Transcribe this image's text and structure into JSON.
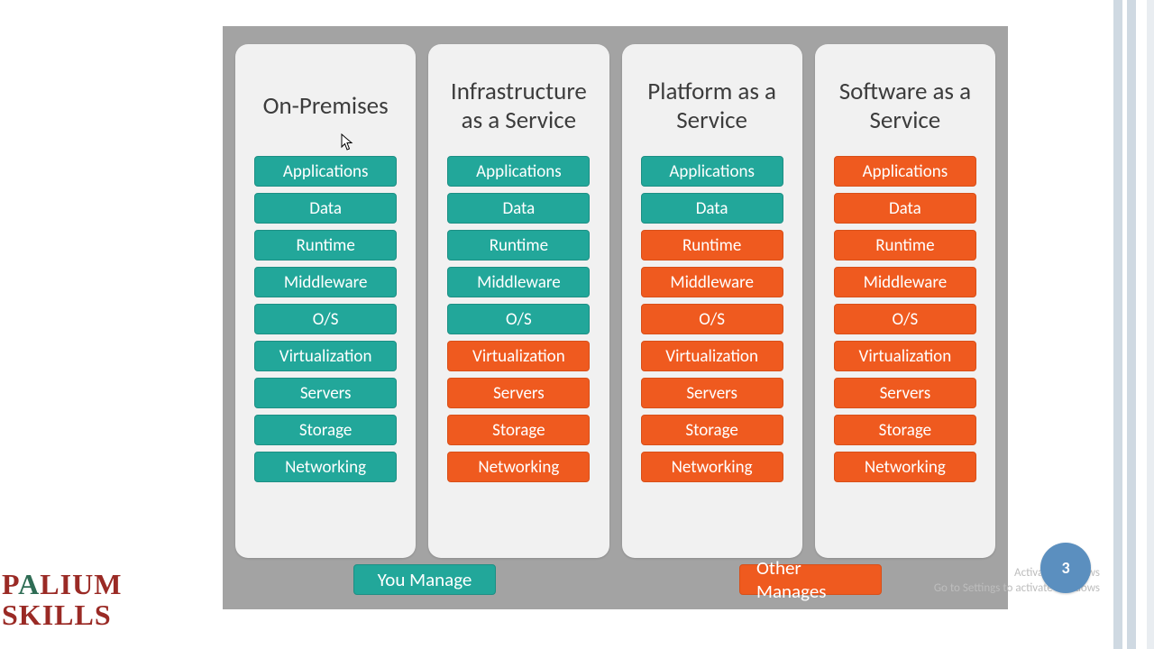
{
  "colors": {
    "teal": "#22a79a",
    "orange": "#ef5a1f",
    "panel": "#a3a3a3"
  },
  "columns": [
    {
      "title": "On-Premises",
      "rows": [
        {
          "label": "Applications",
          "managed": "you"
        },
        {
          "label": "Data",
          "managed": "you"
        },
        {
          "label": "Runtime",
          "managed": "you"
        },
        {
          "label": "Middleware",
          "managed": "you"
        },
        {
          "label": "O/S",
          "managed": "you"
        },
        {
          "label": "Virtualization",
          "managed": "you"
        },
        {
          "label": "Servers",
          "managed": "you"
        },
        {
          "label": "Storage",
          "managed": "you"
        },
        {
          "label": "Networking",
          "managed": "you"
        }
      ]
    },
    {
      "title": "Infrastructure as a Service",
      "rows": [
        {
          "label": "Applications",
          "managed": "you"
        },
        {
          "label": "Data",
          "managed": "you"
        },
        {
          "label": "Runtime",
          "managed": "you"
        },
        {
          "label": "Middleware",
          "managed": "you"
        },
        {
          "label": "O/S",
          "managed": "you"
        },
        {
          "label": "Virtualization",
          "managed": "other"
        },
        {
          "label": "Servers",
          "managed": "other"
        },
        {
          "label": "Storage",
          "managed": "other"
        },
        {
          "label": "Networking",
          "managed": "other"
        }
      ]
    },
    {
      "title": "Platform as a Service",
      "rows": [
        {
          "label": "Applications",
          "managed": "you"
        },
        {
          "label": "Data",
          "managed": "you"
        },
        {
          "label": "Runtime",
          "managed": "other"
        },
        {
          "label": "Middleware",
          "managed": "other"
        },
        {
          "label": "O/S",
          "managed": "other"
        },
        {
          "label": "Virtualization",
          "managed": "other"
        },
        {
          "label": "Servers",
          "managed": "other"
        },
        {
          "label": "Storage",
          "managed": "other"
        },
        {
          "label": "Networking",
          "managed": "other"
        }
      ]
    },
    {
      "title": "Software as a Service",
      "rows": [
        {
          "label": "Applications",
          "managed": "other"
        },
        {
          "label": "Data",
          "managed": "other"
        },
        {
          "label": "Runtime",
          "managed": "other"
        },
        {
          "label": "Middleware",
          "managed": "other"
        },
        {
          "label": "O/S",
          "managed": "other"
        },
        {
          "label": "Virtualization",
          "managed": "other"
        },
        {
          "label": "Servers",
          "managed": "other"
        },
        {
          "label": "Storage",
          "managed": "other"
        },
        {
          "label": "Networking",
          "managed": "other"
        }
      ]
    }
  ],
  "legend": {
    "you": "You Manage",
    "other": "Other Manages"
  },
  "logo": {
    "line1_pre": "P",
    "line1_a": "A",
    "line1_post": "LIUM",
    "line2": "SKILLS"
  },
  "page_number": "3",
  "watermark": {
    "line1": "Activate Windows",
    "line2": "Go to Settings to activate Windows"
  }
}
